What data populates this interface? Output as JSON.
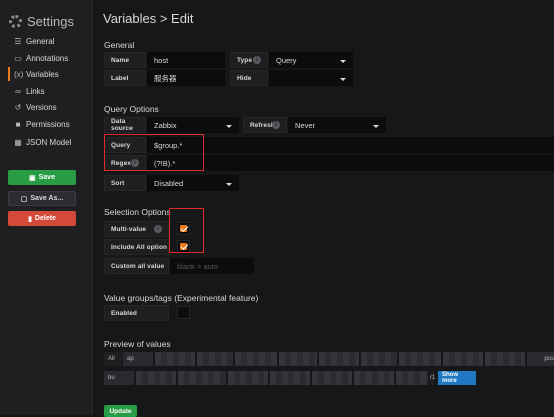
{
  "sidebar": {
    "title": "Settings",
    "items": [
      {
        "label": "General",
        "icon": "sliders-icon"
      },
      {
        "label": "Annotations",
        "icon": "comment-icon"
      },
      {
        "label": "Variables",
        "icon": "braces-icon",
        "active": true
      },
      {
        "label": "Links",
        "icon": "link-icon"
      },
      {
        "label": "Versions",
        "icon": "history-icon"
      },
      {
        "label": "Permissions",
        "icon": "lock-icon"
      },
      {
        "label": "JSON Model",
        "icon": "grid-icon"
      }
    ],
    "save": "Save",
    "save_as": "Save As...",
    "delete": "Delete"
  },
  "page": {
    "title": "Variables > Edit"
  },
  "general": {
    "heading": "General",
    "name_label": "Name",
    "name_value": "host",
    "type_label": "Type",
    "type_value": "Query",
    "label_label": "Label",
    "label_value": "服务器",
    "hide_label": "Hide",
    "hide_value": ""
  },
  "query_options": {
    "heading": "Query Options",
    "datasource_label": "Data source",
    "datasource_value": "Zabbix",
    "refresh_label": "Refresh",
    "refresh_value": "Never",
    "query_label": "Query",
    "query_value": "$group.*",
    "regex_label": "Regex",
    "regex_value": "(?!B).*",
    "sort_label": "Sort",
    "sort_value": "Disabled"
  },
  "selection_options": {
    "heading": "Selection Options",
    "multi_label": "Multi-value",
    "multi_checked": true,
    "include_all_label": "Include All option",
    "include_all_checked": true,
    "custom_all_label": "Custom all value",
    "custom_all_placeholder": "blank = auto"
  },
  "value_groups": {
    "heading": "Value groups/tags (Experimental feature)",
    "enabled_label": "Enabled",
    "enabled_checked": false
  },
  "preview": {
    "heading": "Preview of values",
    "first_chip": "All",
    "chip_row1_start": "ap",
    "chip_row1_end": "pos",
    "chip_row2_start": "bu",
    "chip_row2_end": "r1",
    "show_more": "Show more"
  },
  "update_button": "Update",
  "colors": {
    "accent": "#eb7b18",
    "save": "#299c46",
    "delete": "#e02f44",
    "show_more": "#1f78c1",
    "highlight": "#e02a2a"
  }
}
